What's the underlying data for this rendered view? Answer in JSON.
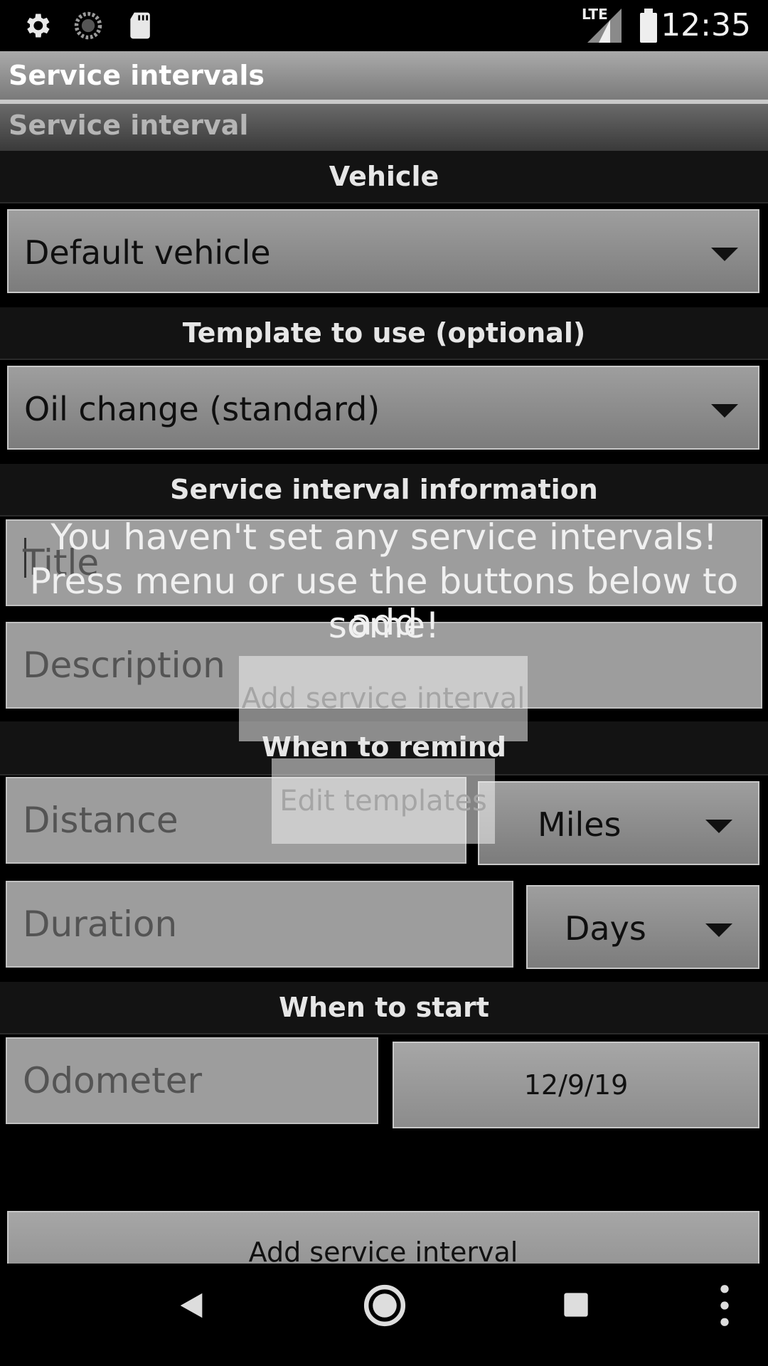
{
  "status_bar": {
    "time": "12:35",
    "network": "LTE",
    "icons": [
      "gear-icon",
      "sync-icon",
      "sd-card-icon",
      "signal-icon",
      "battery-icon"
    ]
  },
  "app_title": "Service intervals",
  "subtitle": "Service interval",
  "sections": {
    "vehicle": "Vehicle",
    "template": "Template to use (optional)",
    "info": "Service interval information",
    "remind": "When to remind",
    "start": "When to start"
  },
  "vehicle_select": {
    "value": "Default vehicle"
  },
  "template_select": {
    "value": "Oil change (standard)"
  },
  "fields": {
    "title_placeholder": "Title",
    "description_placeholder": "Description",
    "distance_placeholder": "Distance",
    "duration_placeholder": "Duration",
    "odometer_placeholder": "Odometer"
  },
  "distance_unit": {
    "value": "Miles"
  },
  "duration_unit": {
    "value": "Days"
  },
  "start_date": "12/9/19",
  "add_button": "Add service interval",
  "empty_overlay": {
    "line1": "You haven't set any service intervals!",
    "line2": "Press menu or use the buttons below to add",
    "line3": "some!",
    "add_button": "Add service interval",
    "edit_button": "Edit templates"
  },
  "colors": {
    "background": "#000000",
    "section_bg": "#131313",
    "control_gray": "#9d9d9d"
  }
}
